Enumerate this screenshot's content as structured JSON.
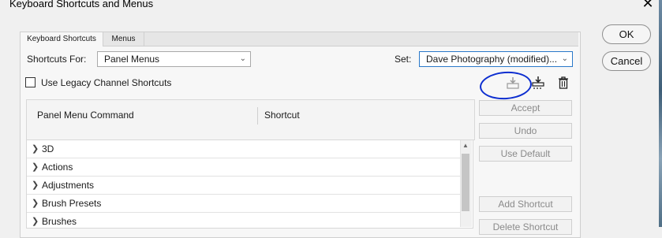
{
  "window": {
    "title": "Keyboard Shortcuts and Menus",
    "close_glyph": "✕"
  },
  "tabs": [
    {
      "label": "Keyboard Shortcuts",
      "active": true
    },
    {
      "label": "Menus",
      "active": false
    }
  ],
  "shortcuts_for": {
    "label": "Shortcuts For:",
    "value": "Panel Menus"
  },
  "set": {
    "label": "Set:",
    "value": "Dave Photography (modified)..."
  },
  "legacy_checkbox": {
    "label": "Use Legacy Channel Shortcuts",
    "checked": false
  },
  "toolbar_icons": [
    "save-set-icon",
    "new-set-icon",
    "delete-set-icon"
  ],
  "table": {
    "columns": [
      "Panel Menu Command",
      "Shortcut"
    ],
    "rows": [
      {
        "label": "3D"
      },
      {
        "label": "Actions"
      },
      {
        "label": "Adjustments"
      },
      {
        "label": "Brush Presets"
      },
      {
        "label": "Brushes"
      }
    ]
  },
  "side_buttons": {
    "accept": "Accept",
    "undo": "Undo",
    "use_default": "Use Default",
    "add_shortcut": "Add Shortcut",
    "delete_shortcut": "Delete Shortcut"
  },
  "dialog_buttons": {
    "ok": "OK",
    "cancel": "Cancel"
  },
  "colors": {
    "annotation": "#0d2ed0",
    "focus_border": "#2a79c9",
    "disabled_text": "#8a8a8a"
  }
}
